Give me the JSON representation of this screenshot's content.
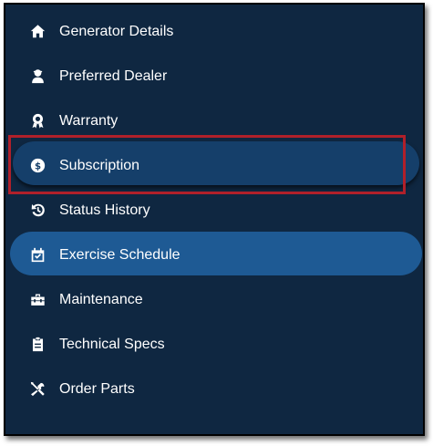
{
  "nav": {
    "items": [
      {
        "label": "Generator Details",
        "icon": "home-icon"
      },
      {
        "label": "Preferred Dealer",
        "icon": "user-icon"
      },
      {
        "label": "Warranty",
        "icon": "award-ribbon-icon"
      },
      {
        "label": "Subscription",
        "icon": "dollar-circle-icon"
      },
      {
        "label": "Status History",
        "icon": "history-icon"
      },
      {
        "label": "Exercise Schedule",
        "icon": "calendar-check-icon"
      },
      {
        "label": "Maintenance",
        "icon": "toolbox-icon"
      },
      {
        "label": "Technical Specs",
        "icon": "clipboard-icon"
      },
      {
        "label": "Order Parts",
        "icon": "wrench-screwdriver-icon"
      }
    ],
    "active_item": "Exercise Schedule",
    "hovered_item": "Subscription"
  },
  "colors": {
    "panel_background": "#0f2741",
    "active_pill": "#1e5a94",
    "hover_pill": "#153f6a",
    "highlight_border": "#b0202a",
    "text": "#ffffff"
  }
}
